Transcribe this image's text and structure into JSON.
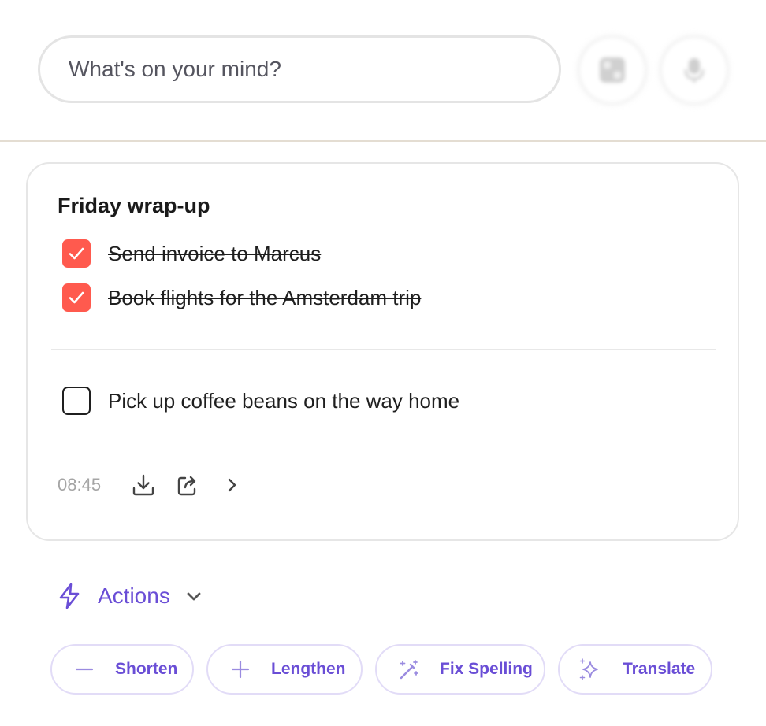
{
  "composer": {
    "placeholder": "What's on your mind?",
    "buttons": [
      {
        "icon": "image-icon"
      },
      {
        "icon": "microphone-icon"
      }
    ]
  },
  "note": {
    "title": "Friday wrap-up",
    "completed_tasks": [
      {
        "label": "Send invoice to Marcus",
        "checked": true
      },
      {
        "label": "Book flights for the Amsterdam trip",
        "checked": true
      }
    ],
    "open_tasks": [
      {
        "label": "Pick up coffee beans on the way home",
        "checked": false
      }
    ],
    "time": "08:45",
    "footer_icons": [
      "download-icon",
      "share-icon",
      "chevron-right-icon"
    ]
  },
  "actions": {
    "label": "Actions",
    "icon": "lightning-icon",
    "chips": [
      {
        "label": "Shorten",
        "icon": "minus-icon"
      },
      {
        "label": "Lengthen",
        "icon": "plus-icon"
      },
      {
        "label": "Fix Spelling",
        "icon": "magic-wand-icon"
      },
      {
        "label": "Translate",
        "icon": "sparkle-icon"
      }
    ]
  },
  "colors": {
    "accent": "#6a4ed6",
    "checkbox_checked": "#ff5a4e",
    "chip_border": "#e2dcf7"
  }
}
